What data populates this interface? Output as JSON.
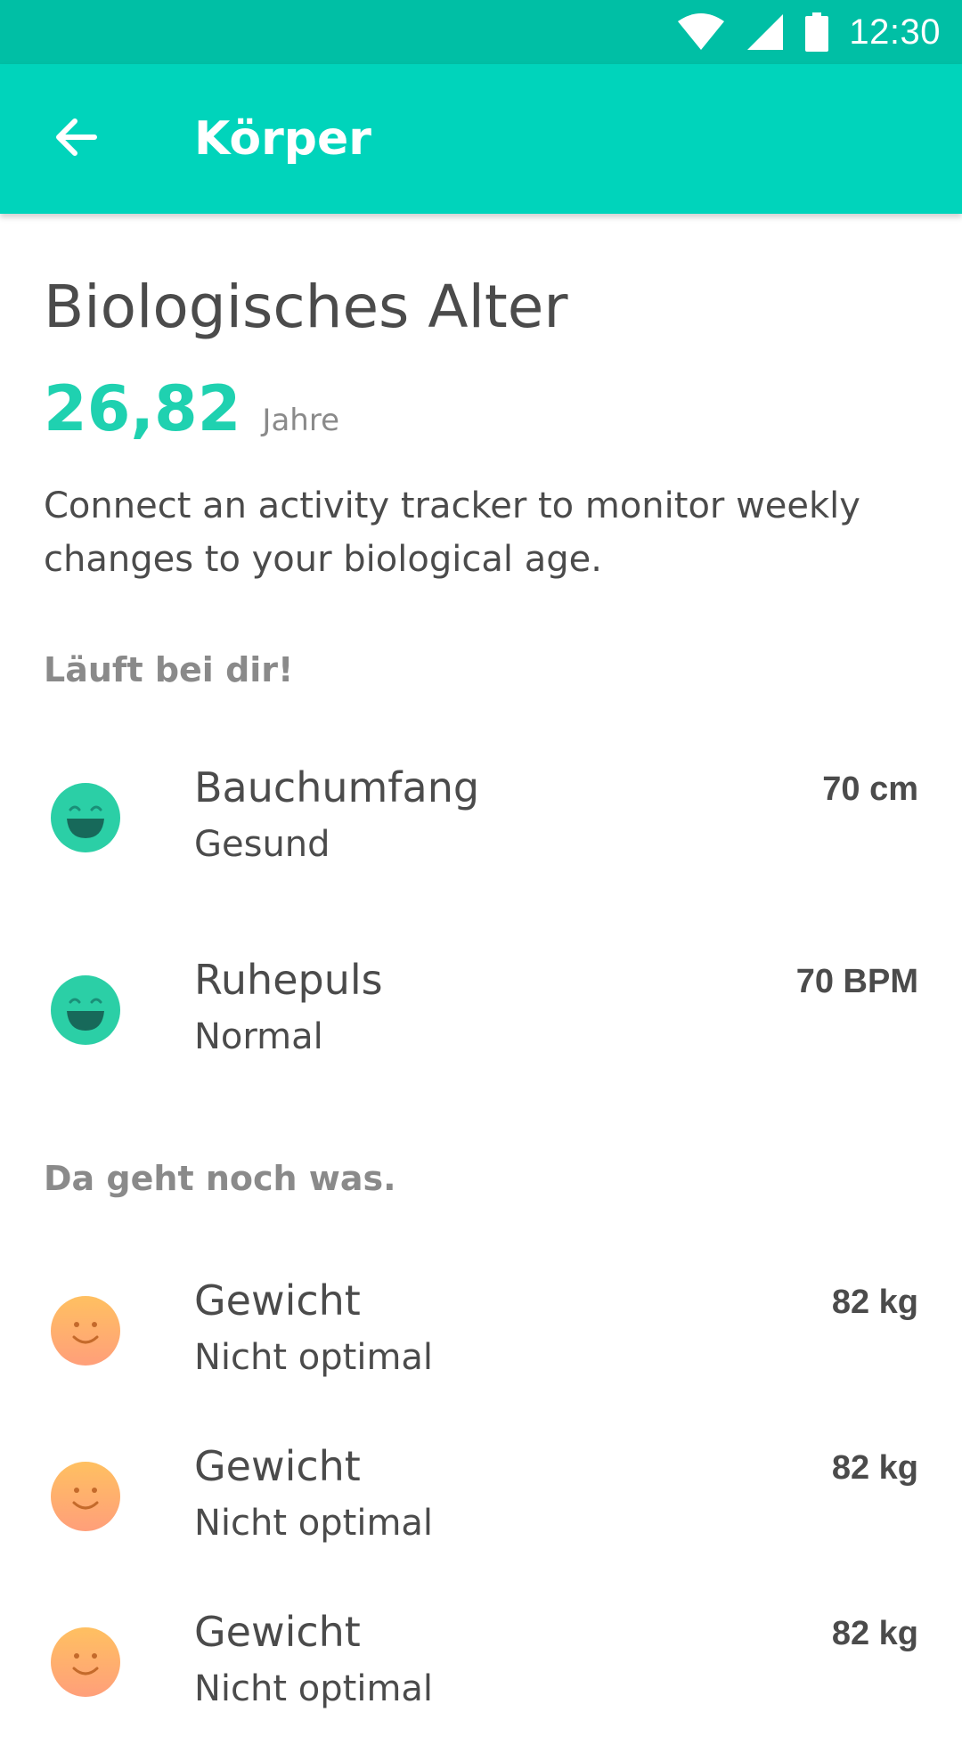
{
  "status_bar": {
    "time": "12:30",
    "icons": [
      "wifi-icon",
      "signal-icon",
      "battery-icon"
    ]
  },
  "app_bar": {
    "back_icon": "arrow-back-icon",
    "title": "Körper"
  },
  "main": {
    "title": "Biologisches Alter",
    "age_value": "26,82",
    "age_unit": "Jahre",
    "description": "Connect an activity tracker to monitor weekly changes to your biological age."
  },
  "groups": [
    {
      "label": "Läuft bei dir!",
      "items": [
        {
          "name": "Bauchumfang",
          "status": "Gesund",
          "value": "70 cm",
          "icon": "happy-face-icon"
        },
        {
          "name": "Ruhepuls",
          "status": "Normal",
          "value": "70 BPM",
          "icon": "happy-face-icon"
        }
      ]
    },
    {
      "label": "Da geht noch was.",
      "items": [
        {
          "name": "Gewicht",
          "status": "Nicht optimal",
          "value": "82 kg",
          "icon": "smile-face-icon"
        },
        {
          "name": "Gewicht",
          "status": "Nicht optimal",
          "value": "82 kg",
          "icon": "smile-face-icon"
        },
        {
          "name": "Gewicht",
          "status": "Nicht optimal",
          "value": "82 kg",
          "icon": "smile-face-icon"
        }
      ]
    }
  ],
  "colors": {
    "status_bar": "#00bfa5",
    "app_bar": "#00d4bb",
    "accent": "#1fd1b0",
    "happy_face": "#2bcfa6",
    "warning_face_top": "#ffc061",
    "warning_face_bottom": "#ff9f7a"
  }
}
